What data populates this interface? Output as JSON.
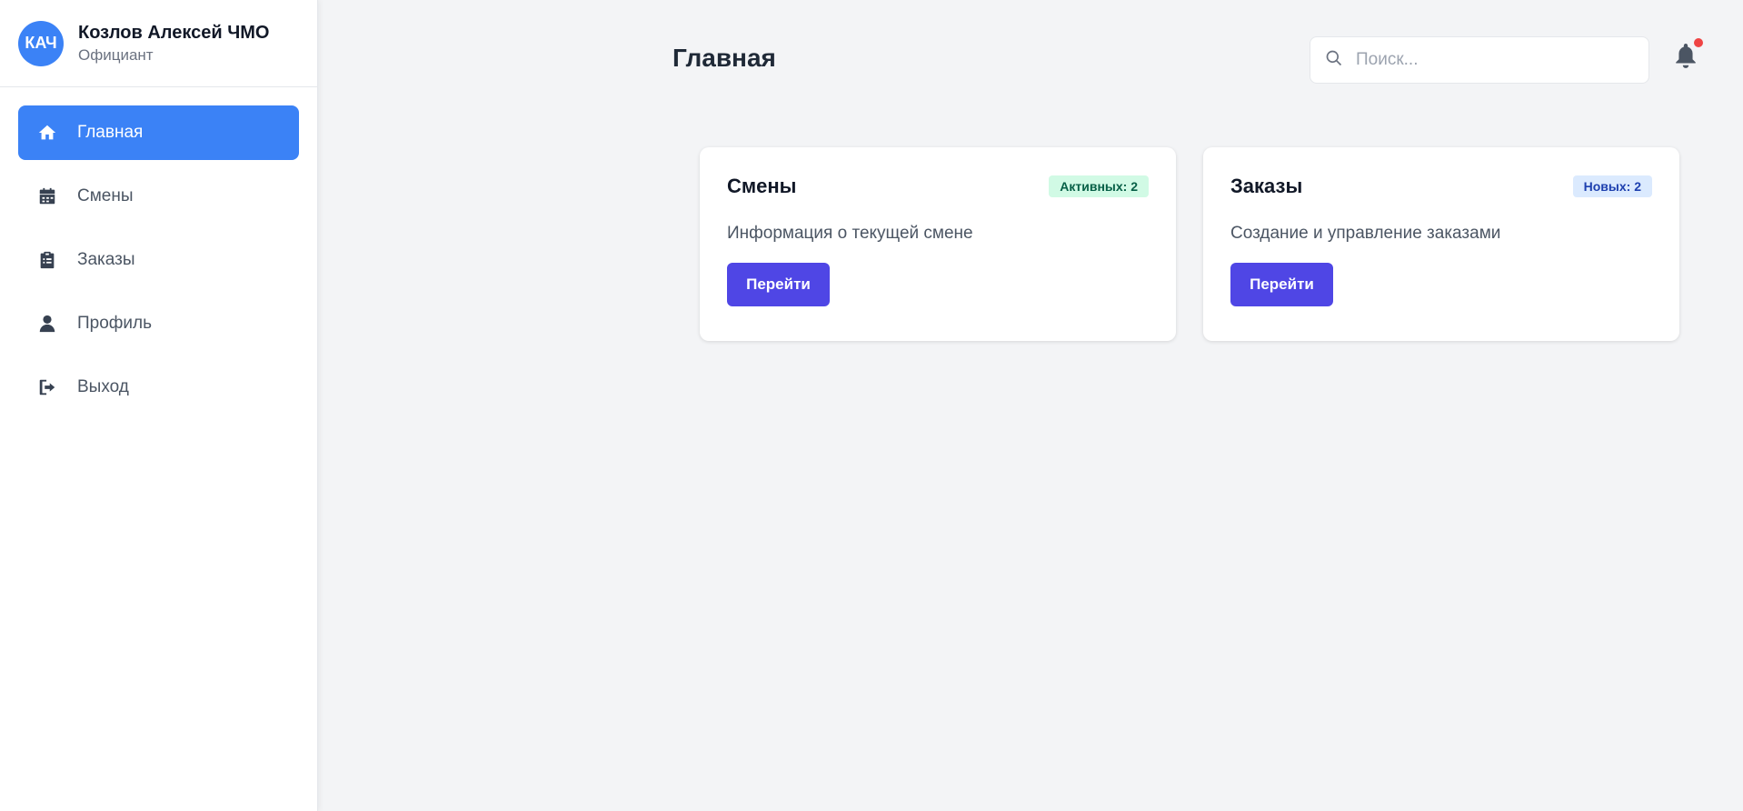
{
  "user": {
    "initials": "КАЧ",
    "name": "Козлов Алексей ЧМО",
    "role": "Официант"
  },
  "nav": {
    "items": [
      {
        "label": "Главная",
        "icon": "home-icon",
        "active": true
      },
      {
        "label": "Смены",
        "icon": "calendar-icon",
        "active": false
      },
      {
        "label": "Заказы",
        "icon": "clipboard-list-icon",
        "active": false
      },
      {
        "label": "Профиль",
        "icon": "user-icon",
        "active": false
      },
      {
        "label": "Выход",
        "icon": "sign-out-icon",
        "active": false
      }
    ]
  },
  "header": {
    "title": "Главная",
    "search_placeholder": "Поиск...",
    "notification_icon": "bell-icon",
    "has_notifications": true
  },
  "cards": [
    {
      "title": "Смены",
      "badge": "Активных: 2",
      "badge_color": "#d1fae5",
      "description": "Информация о текущей смене",
      "button_label": "Перейти"
    },
    {
      "title": "Заказы",
      "badge": "Новых: 2",
      "badge_color": "#dbeafe",
      "description": "Создание и управление заказами",
      "button_label": "Перейти"
    }
  ],
  "colors": {
    "accent": "#3b82f6",
    "button": "#4f46e5",
    "notification_dot": "#ef4444"
  }
}
